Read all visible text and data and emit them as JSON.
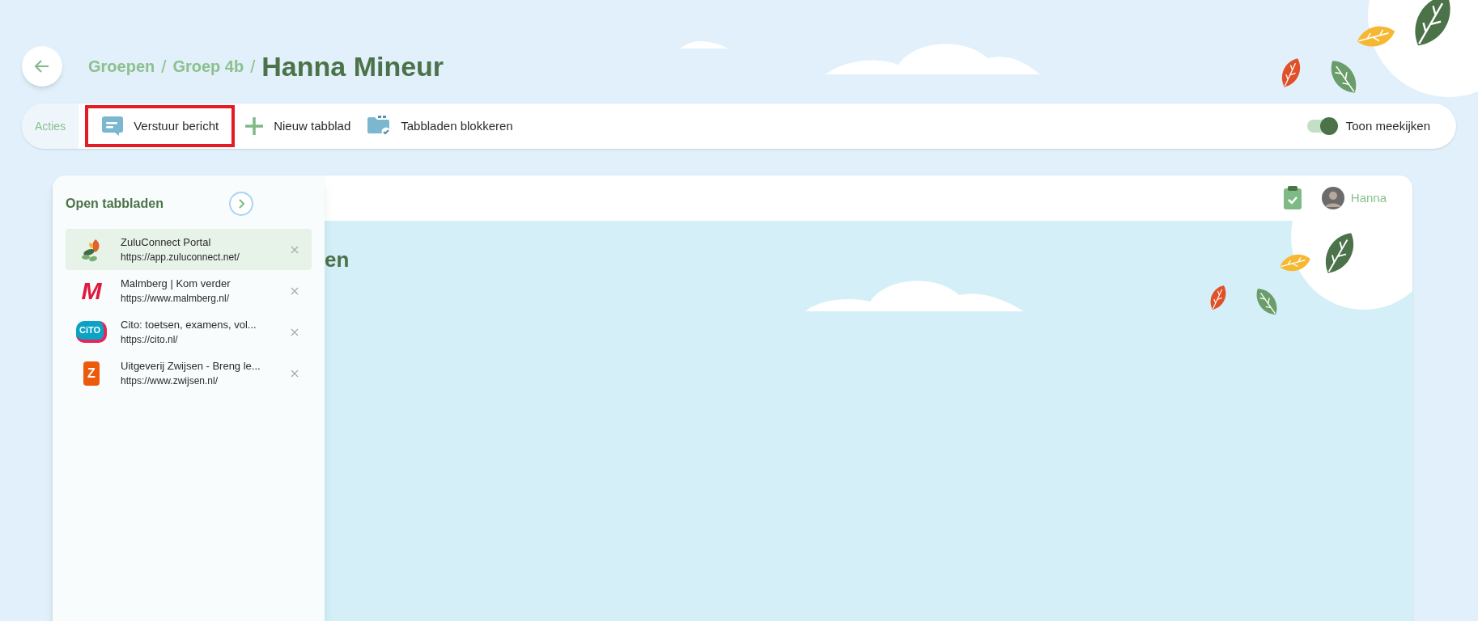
{
  "breadcrumb": [
    {
      "label": "Groepen",
      "separator": "/"
    },
    {
      "label": "Groep 4b",
      "separator": "/"
    }
  ],
  "title": "Hanna Mineur",
  "toolbar": {
    "label": "Acties",
    "actions": [
      {
        "kind": "message",
        "label": "Verstuur bericht",
        "highlighted": true
      },
      {
        "kind": "add",
        "label": "Nieuw tabblad",
        "highlighted": false
      },
      {
        "kind": "block",
        "label": "Tabbladen blokkeren",
        "highlighted": false
      }
    ],
    "toggle": {
      "label": "Toon meekijken",
      "on": true
    }
  },
  "panel": {
    "title": "Open tabbladen",
    "tabs": [
      {
        "kind": "zulu",
        "title": "ZuluConnect Portal",
        "url": "https://app.zuluconnect.net/",
        "selected": true
      },
      {
        "kind": "malmberg",
        "logo": "M",
        "title": "Malmberg | Kom verder",
        "url": "https://www.malmberg.nl/",
        "selected": false
      },
      {
        "kind": "cito",
        "logo": "CiTO",
        "title": "Cito: toetsen, examens, vol...",
        "url": "https://cito.nl/",
        "selected": false
      },
      {
        "kind": "zwijsen",
        "logo": "Z",
        "title": "Uitgeverij Zwijsen - Breng le...",
        "url": "https://www.zwijsen.nl/",
        "selected": false
      }
    ]
  },
  "viewer": {
    "heading": "en",
    "user": "Hanna"
  }
}
